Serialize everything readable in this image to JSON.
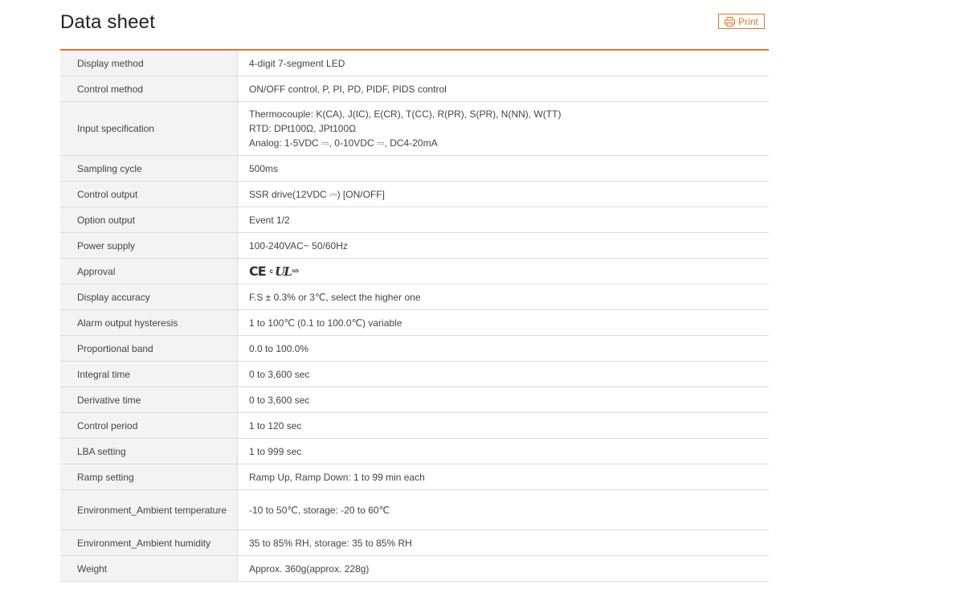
{
  "header": {
    "title": "Data sheet",
    "print_label": "Print"
  },
  "accent_color": "#e8732c",
  "approval_marks": {
    "ce": "CE",
    "c": "c",
    "ul": "UL",
    "us": "us"
  },
  "rows": [
    {
      "label": "Display method",
      "values": [
        "4-digit 7-segment LED"
      ]
    },
    {
      "label": "Control method",
      "values": [
        "ON/OFF control, P, PI, PD, PIDF, PIDS control"
      ]
    },
    {
      "label": "Input specification",
      "values": [
        "Thermocouple: K(CA), J(IC), E(CR), T(CC), R(PR), S(PR), N(NN), W(TT)",
        "RTD: DPt100Ω, JPt100Ω",
        "Analog: 1-5VDC ⎓, 0-10VDC ⎓, DC4-20mA"
      ]
    },
    {
      "label": "Sampling cycle",
      "values": [
        "500ms"
      ]
    },
    {
      "label": "Control output",
      "values": [
        "SSR drive(12VDC ⎓) [ON/OFF]"
      ]
    },
    {
      "label": "Option output",
      "values": [
        "Event 1/2"
      ]
    },
    {
      "label": "Power supply",
      "values": [
        "100-240VAC~ 50/60Hz"
      ]
    },
    {
      "label": "Approval",
      "values": []
    },
    {
      "label": "Display accuracy",
      "values": [
        "F.S ± 0.3% or 3℃, select the higher one"
      ]
    },
    {
      "label": "Alarm output hysteresis",
      "values": [
        "1 to 100℃ (0.1 to 100.0℃) variable"
      ]
    },
    {
      "label": "Proportional band",
      "values": [
        "0.0 to 100.0%"
      ]
    },
    {
      "label": "Integral time",
      "values": [
        "0 to 3,600 sec"
      ]
    },
    {
      "label": "Derivative time",
      "values": [
        "0 to 3,600 sec"
      ]
    },
    {
      "label": "Control period",
      "values": [
        "1 to 120 sec"
      ]
    },
    {
      "label": "LBA setting",
      "values": [
        "1 to 999 sec"
      ]
    },
    {
      "label": "Ramp setting",
      "values": [
        "Ramp Up, Ramp Down: 1 to 99 min each"
      ]
    },
    {
      "label": "Environment_Ambient temperature",
      "values": [
        "-10 to 50℃, storage: -20 to 60℃"
      ]
    },
    {
      "label": "Environment_Ambient humidity",
      "values": [
        "35 to 85% RH, storage: 35 to 85% RH"
      ]
    },
    {
      "label": "Weight",
      "values": [
        "Approx. 360g(approx. 228g)"
      ]
    }
  ]
}
